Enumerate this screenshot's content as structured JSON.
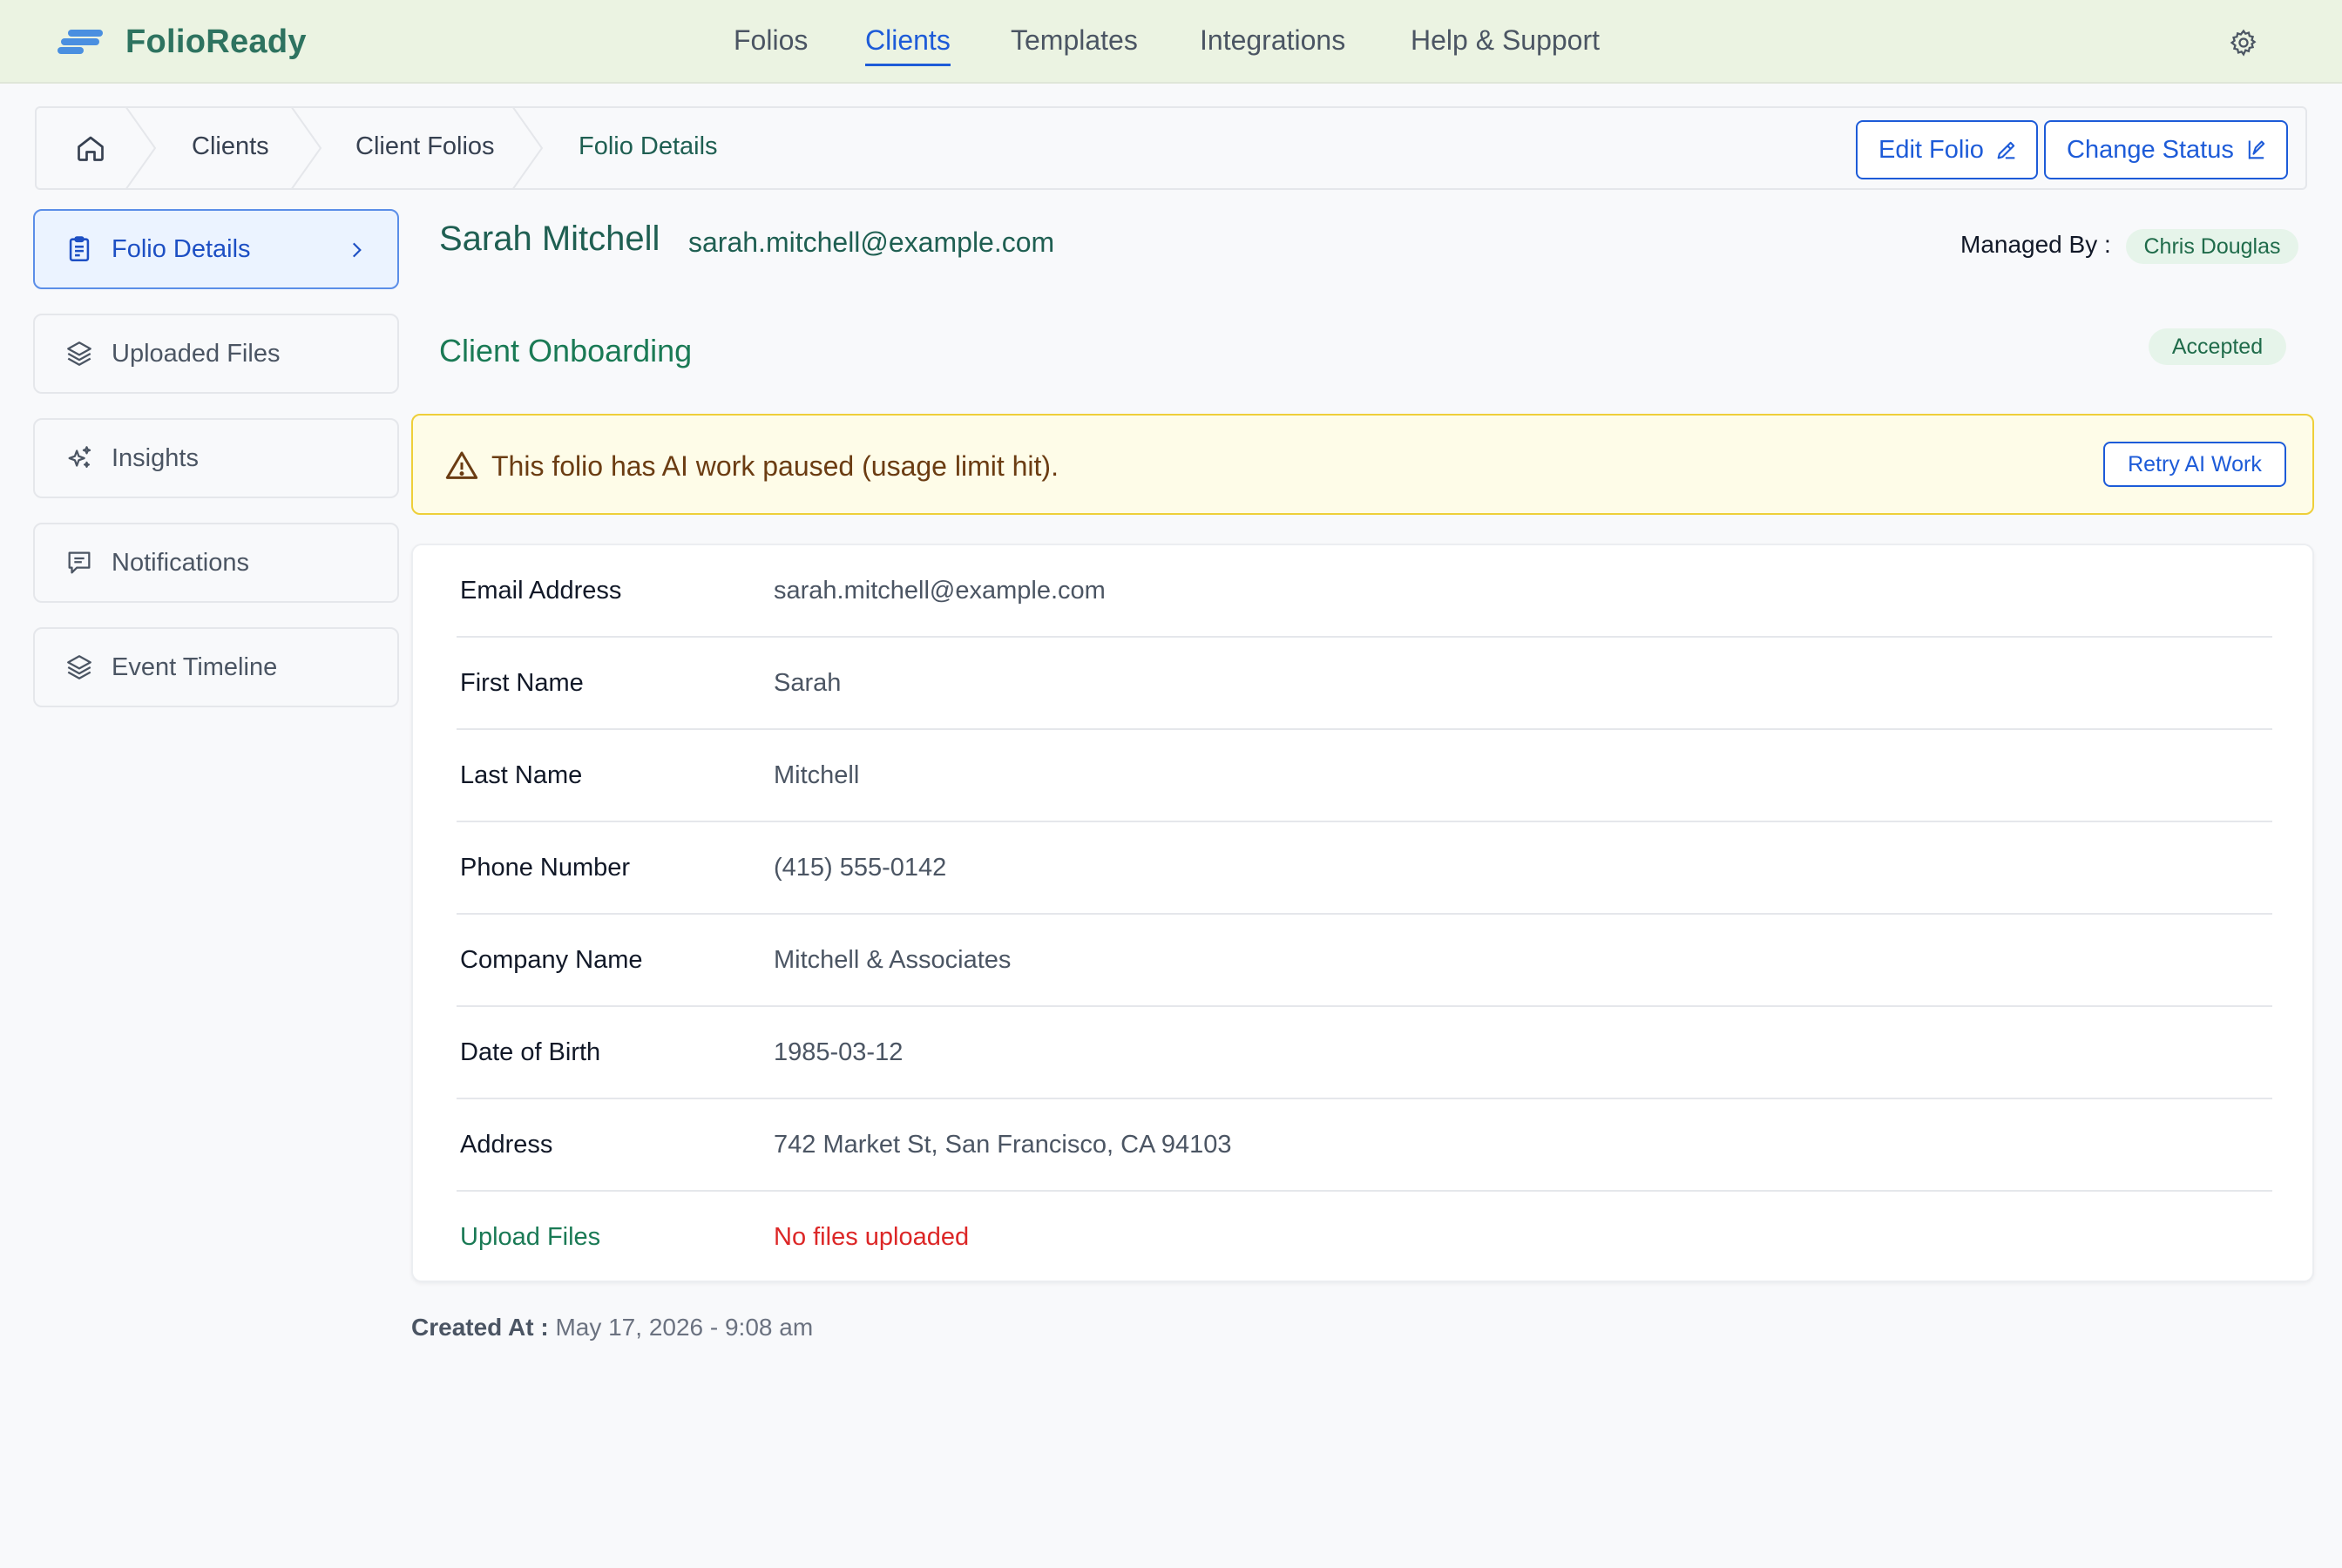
{
  "app": {
    "name": "FolioReady"
  },
  "colors": {
    "accent": "#1d5bd8",
    "brand_green": "#2e7360",
    "topbar": "#ebf3e2",
    "warning_bg": "#fefce8",
    "error": "#dc2626"
  },
  "nav": {
    "items": [
      {
        "label": "Folios"
      },
      {
        "label": "Clients",
        "active": true
      },
      {
        "label": "Templates"
      },
      {
        "label": "Integrations"
      },
      {
        "label": "Help & Support"
      }
    ],
    "settings_icon": "gear-icon"
  },
  "breadcrumb": {
    "home_icon": "home-icon",
    "items": [
      "Clients",
      "Client Folios",
      "Folio Details"
    ]
  },
  "actions": {
    "edit_label": "Edit Folio",
    "change_status_label": "Change Status"
  },
  "sidebar": {
    "items": [
      {
        "label": "Folio Details",
        "icon": "clipboard-icon",
        "active": true
      },
      {
        "label": "Uploaded Files",
        "icon": "layers-icon"
      },
      {
        "label": "Insights",
        "icon": "sparkles-icon"
      },
      {
        "label": "Notifications",
        "icon": "message-icon"
      },
      {
        "label": "Event Timeline",
        "icon": "layers-icon"
      }
    ]
  },
  "client": {
    "name": "Sarah Mitchell",
    "email": "sarah.mitchell@example.com",
    "managed_by_label": "Managed By :",
    "manager": "Chris Douglas"
  },
  "section": {
    "title": "Client Onboarding",
    "status": "Accepted"
  },
  "alert": {
    "message": "This folio has AI work paused (usage limit hit).",
    "action": "Retry AI Work"
  },
  "details": [
    {
      "label": "Email Address",
      "value": "sarah.mitchell@example.com"
    },
    {
      "label": "First Name",
      "value": "Sarah"
    },
    {
      "label": "Last Name",
      "value": "Mitchell"
    },
    {
      "label": "Phone Number",
      "value": "(415) 555-0142"
    },
    {
      "label": "Company Name",
      "value": "Mitchell & Associates"
    },
    {
      "label": "Date of Birth",
      "value": "1985-03-12"
    },
    {
      "label": "Address",
      "value": "742 Market St, San Francisco, CA 94103"
    },
    {
      "label": "Upload Files",
      "value": "No files uploaded"
    }
  ],
  "created": {
    "label": "Created At :",
    "value": "May 17, 2026 - 9:08 am"
  }
}
